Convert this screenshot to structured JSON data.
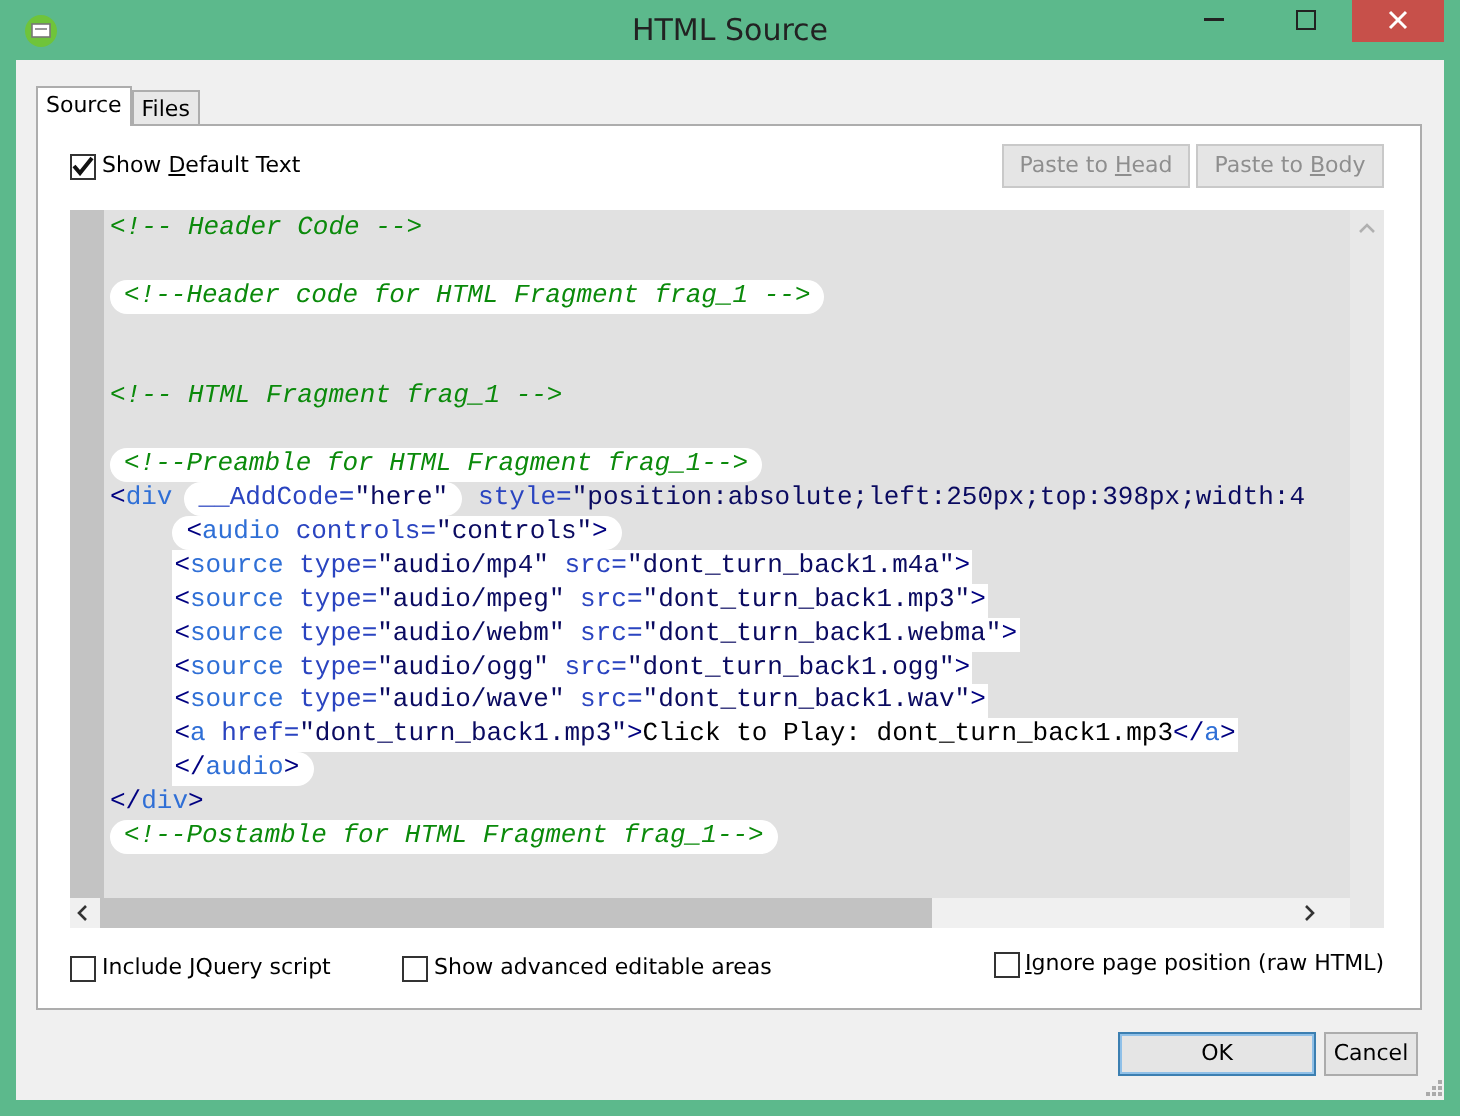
{
  "window": {
    "title": "HTML Source"
  },
  "tabs": [
    {
      "label": "Source",
      "selected": true
    },
    {
      "label": "Files",
      "selected": false
    }
  ],
  "show_default_text": {
    "label_before": "Show ",
    "access_key": "D",
    "label_after": "efault Text",
    "checked": true
  },
  "paste_buttons": [
    {
      "label_before": "Paste to ",
      "access_key": "H",
      "label_after": "ead",
      "disabled": true
    },
    {
      "label_before": "Paste to ",
      "access_key": "B",
      "label_after": "ody",
      "disabled": true
    }
  ],
  "code_lines": [
    {
      "kind": "code",
      "indented": false,
      "segments": [
        {
          "kind": "plain",
          "tokens": [
            {
              "kind": "comment",
              "text": "<!-- Header Code -->"
            }
          ]
        }
      ]
    },
    {
      "kind": "blank"
    },
    {
      "kind": "code",
      "indented": false,
      "segments": [
        {
          "kind": "pill",
          "tokens": [
            {
              "kind": "comment",
              "text": "<!--Header code for HTML Fragment frag_1 -->"
            }
          ]
        }
      ]
    },
    {
      "kind": "blank"
    },
    {
      "kind": "blank"
    },
    {
      "kind": "code",
      "indented": false,
      "segments": [
        {
          "kind": "plain",
          "tokens": [
            {
              "kind": "comment",
              "text": "<!-- HTML Fragment frag_1 -->"
            }
          ]
        }
      ]
    },
    {
      "kind": "blank"
    },
    {
      "kind": "code",
      "indented": false,
      "segments": [
        {
          "kind": "pill",
          "tokens": [
            {
              "kind": "comment",
              "text": "<!--Preamble for HTML Fragment frag_1-->"
            }
          ]
        }
      ]
    },
    {
      "kind": "code",
      "indented": false,
      "segments": [
        {
          "kind": "plain",
          "tokens": [
            {
              "kind": "punct",
              "text": "<"
            },
            {
              "kind": "tag",
              "text": "div"
            }
          ]
        },
        {
          "kind": "pill",
          "tokens": [
            {
              "kind": "attr",
              "text": "__AddCode="
            },
            {
              "kind": "value",
              "text": "\"here\""
            }
          ]
        },
        {
          "kind": "plain",
          "tokens": [
            {
              "kind": "attr",
              "text": "style="
            },
            {
              "kind": "value",
              "text": "\"position:absolute;left:250px;top:398px;width:4"
            }
          ]
        }
      ]
    },
    {
      "kind": "code",
      "indented": true,
      "segments": [
        {
          "kind": "pill",
          "tokens": [
            {
              "kind": "punct",
              "text": "<"
            },
            {
              "kind": "tag",
              "text": "audio"
            },
            {
              "kind": "attr",
              "text": " controls="
            },
            {
              "kind": "value",
              "text": "\"controls\""
            },
            {
              "kind": "punct",
              "text": ">"
            }
          ]
        }
      ]
    },
    {
      "kind": "code",
      "indented": true,
      "segments": [
        {
          "kind": "block",
          "tokens": [
            {
              "kind": "punct",
              "text": "<"
            },
            {
              "kind": "tag",
              "text": "source"
            },
            {
              "kind": "attr",
              "text": " type="
            },
            {
              "kind": "value",
              "text": "\"audio/mp4\""
            },
            {
              "kind": "attr",
              "text": " src="
            },
            {
              "kind": "value",
              "text": "\"dont_turn_back1.m4a\""
            },
            {
              "kind": "punct",
              "text": ">"
            }
          ]
        }
      ]
    },
    {
      "kind": "code",
      "indented": true,
      "segments": [
        {
          "kind": "block",
          "tokens": [
            {
              "kind": "punct",
              "text": "<"
            },
            {
              "kind": "tag",
              "text": "source"
            },
            {
              "kind": "attr",
              "text": " type="
            },
            {
              "kind": "value",
              "text": "\"audio/mpeg\""
            },
            {
              "kind": "attr",
              "text": " src="
            },
            {
              "kind": "value",
              "text": "\"dont_turn_back1.mp3\""
            },
            {
              "kind": "punct",
              "text": ">"
            }
          ]
        }
      ]
    },
    {
      "kind": "code",
      "indented": true,
      "segments": [
        {
          "kind": "block",
          "tokens": [
            {
              "kind": "punct",
              "text": "<"
            },
            {
              "kind": "tag",
              "text": "source"
            },
            {
              "kind": "attr",
              "text": " type="
            },
            {
              "kind": "value",
              "text": "\"audio/webm\""
            },
            {
              "kind": "attr",
              "text": " src="
            },
            {
              "kind": "value",
              "text": "\"dont_turn_back1.webma\""
            },
            {
              "kind": "punct",
              "text": ">"
            }
          ]
        }
      ]
    },
    {
      "kind": "code",
      "indented": true,
      "segments": [
        {
          "kind": "block",
          "tokens": [
            {
              "kind": "punct",
              "text": "<"
            },
            {
              "kind": "tag",
              "text": "source"
            },
            {
              "kind": "attr",
              "text": " type="
            },
            {
              "kind": "value",
              "text": "\"audio/ogg\""
            },
            {
              "kind": "attr",
              "text": " src="
            },
            {
              "kind": "value",
              "text": "\"dont_turn_back1.ogg\""
            },
            {
              "kind": "punct",
              "text": ">"
            }
          ]
        }
      ]
    },
    {
      "kind": "code",
      "indented": true,
      "segments": [
        {
          "kind": "block",
          "tokens": [
            {
              "kind": "punct",
              "text": "<"
            },
            {
              "kind": "tag",
              "text": "source"
            },
            {
              "kind": "attr",
              "text": " type="
            },
            {
              "kind": "value",
              "text": "\"audio/wave\""
            },
            {
              "kind": "attr",
              "text": " src="
            },
            {
              "kind": "value",
              "text": "\"dont_turn_back1.wav\""
            },
            {
              "kind": "punct",
              "text": ">"
            }
          ]
        }
      ]
    },
    {
      "kind": "code",
      "indented": true,
      "segments": [
        {
          "kind": "block",
          "tokens": [
            {
              "kind": "punct",
              "text": "<"
            },
            {
              "kind": "tag",
              "text": "a"
            },
            {
              "kind": "attr",
              "text": " href="
            },
            {
              "kind": "value",
              "text": "\"dont_turn_back1.mp3\""
            },
            {
              "kind": "punct",
              "text": ">"
            },
            {
              "kind": "text",
              "text": "Click to Play: dont_turn_back1.mp3"
            },
            {
              "kind": "punct",
              "text": "</"
            },
            {
              "kind": "tag",
              "text": "a"
            },
            {
              "kind": "punct",
              "text": ">"
            }
          ]
        }
      ]
    },
    {
      "kind": "code",
      "indented": true,
      "segments": [
        {
          "kind": "block_end",
          "tokens": [
            {
              "kind": "punct",
              "text": "</"
            },
            {
              "kind": "tag",
              "text": "audio"
            },
            {
              "kind": "punct",
              "text": ">"
            }
          ]
        }
      ]
    },
    {
      "kind": "code",
      "indented": false,
      "segments": [
        {
          "kind": "plain",
          "tokens": [
            {
              "kind": "punct",
              "text": "</"
            },
            {
              "kind": "tag",
              "text": "div"
            },
            {
              "kind": "punct",
              "text": ">"
            }
          ]
        }
      ]
    },
    {
      "kind": "code",
      "indented": false,
      "segments": [
        {
          "kind": "pill",
          "tokens": [
            {
              "kind": "comment",
              "text": "<!--Postamble for HTML Fragment frag_1-->"
            }
          ]
        }
      ]
    }
  ],
  "options": [
    {
      "label": "Include JQuery script",
      "checked": false
    },
    {
      "label": "Show advanced editable areas",
      "checked": false
    },
    {
      "access_key": "I",
      "label_after": "gnore page position (raw HTML)",
      "checked": false
    }
  ],
  "buttons": [
    {
      "label": "OK",
      "default": true
    },
    {
      "label": "Cancel",
      "default": false
    }
  ]
}
